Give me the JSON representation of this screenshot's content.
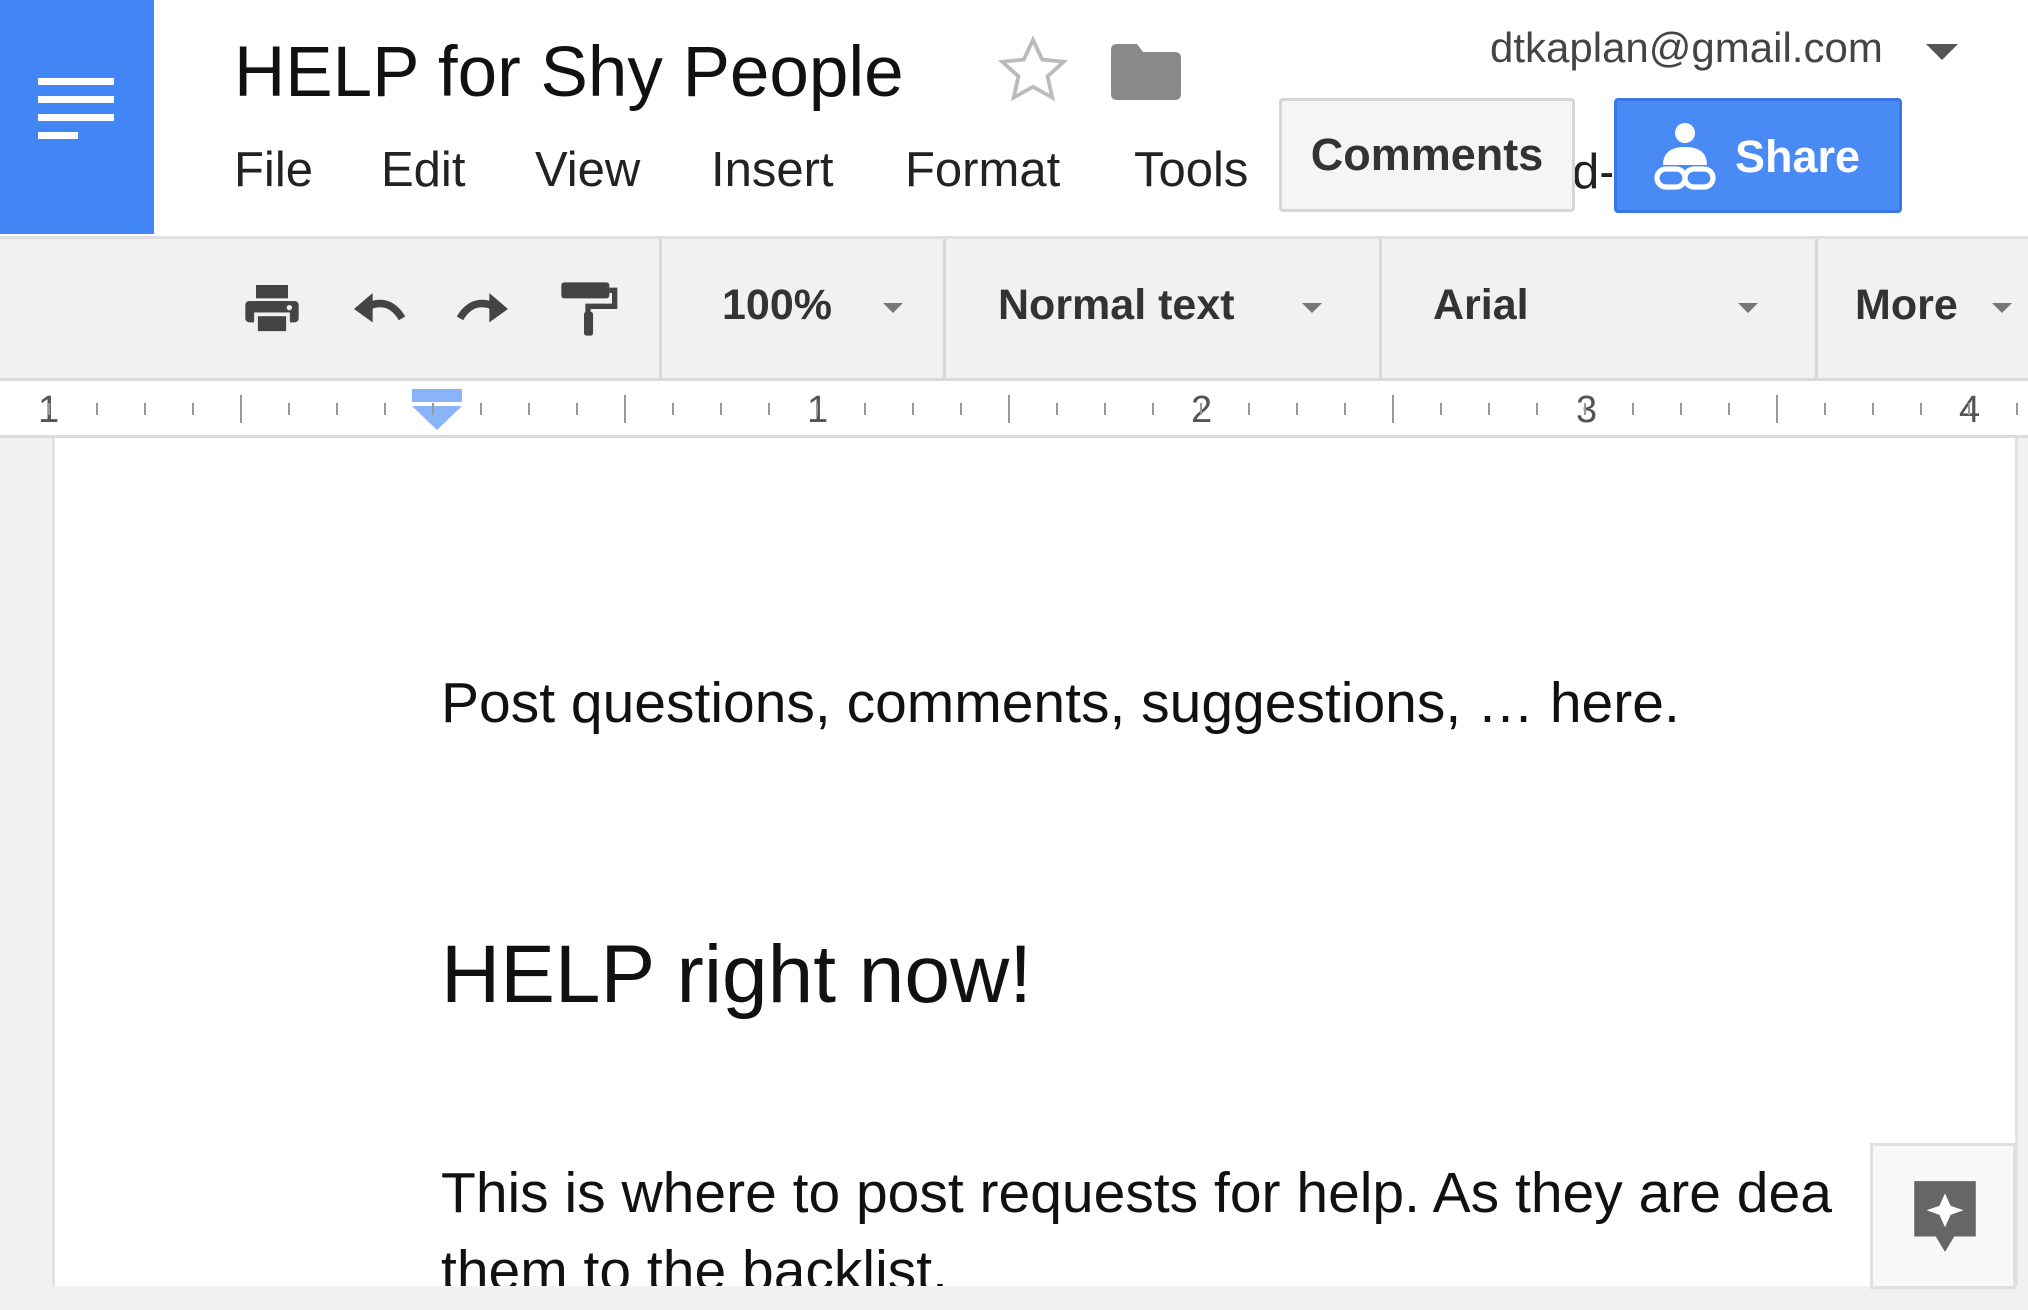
{
  "doc": {
    "title": "HELP for Shy People"
  },
  "account": {
    "email": "dtkaplan@gmail.com"
  },
  "menu": [
    "File",
    "Edit",
    "View",
    "Insert",
    "Format",
    "Tools"
  ],
  "menu_overflow_fragment": "d-",
  "buttons": {
    "comments": "Comments",
    "share": "Share"
  },
  "toolbar": {
    "zoom": "100%",
    "style": "Normal text",
    "font": "Arial",
    "more": "More"
  },
  "ruler": {
    "labels": [
      "1",
      "1",
      "2",
      "3",
      "4"
    ]
  },
  "content": {
    "paragraph1": "Post questions, comments, suggestions, … here.",
    "heading": "HELP right now!",
    "paragraph2_line1": "This is where to post requests for help. As they are dea",
    "paragraph2_line2": "them to the backlist."
  },
  "colors": {
    "brand": "#4285f4",
    "share": "#4a8af4"
  },
  "icons": [
    "docs-menu-icon",
    "star-icon",
    "folder-icon",
    "share-icon",
    "print-icon",
    "undo-icon",
    "redo-icon",
    "paint-format-icon",
    "explore-icon"
  ]
}
